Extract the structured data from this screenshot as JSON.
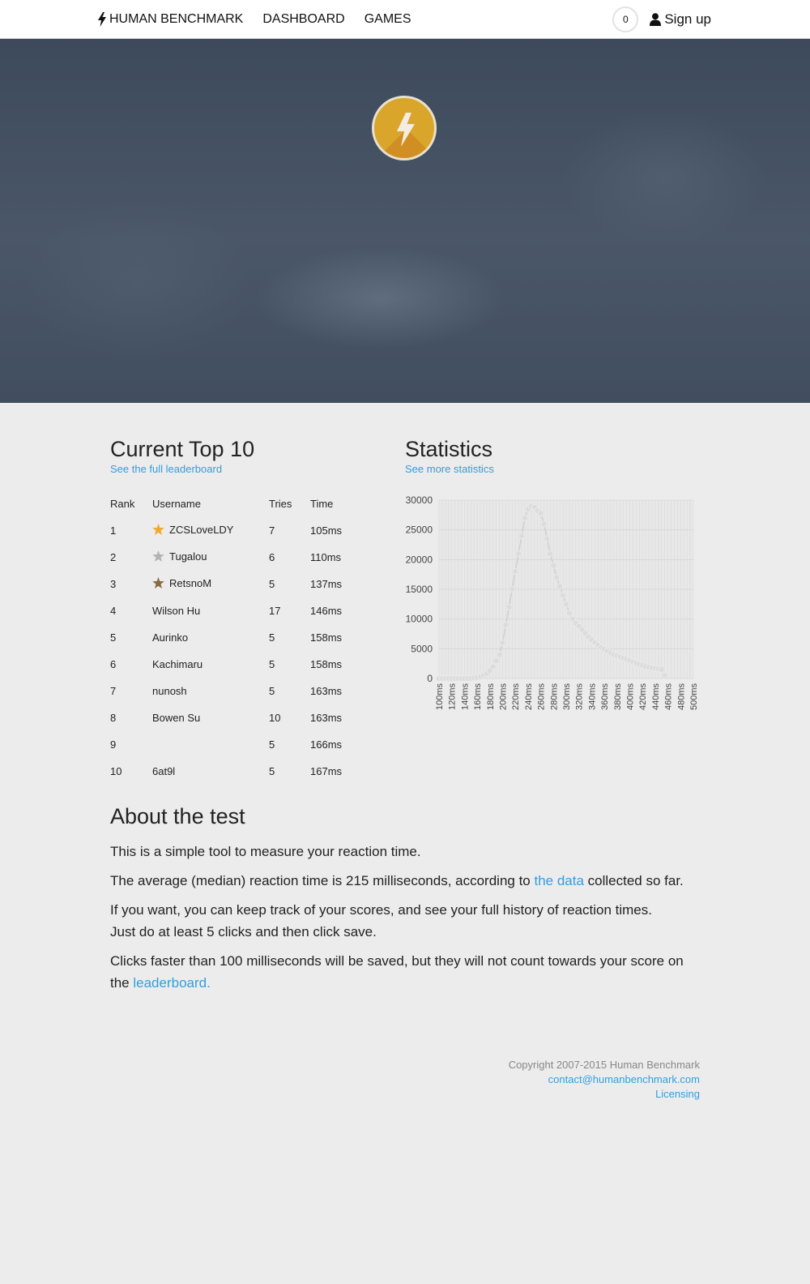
{
  "nav": {
    "brand": "HUMAN BENCHMARK",
    "links": [
      "DASHBOARD",
      "GAMES"
    ],
    "score": "0",
    "signup": "Sign up"
  },
  "top10": {
    "title": "Current Top 10",
    "link": "See the full leaderboard",
    "headers": [
      "Rank",
      "Username",
      "Tries",
      "Time"
    ],
    "rows": [
      {
        "rank": "1",
        "user": "ZCSLoveLDY",
        "tries": "7",
        "time": "105ms",
        "star": "gold"
      },
      {
        "rank": "2",
        "user": "Tugalou",
        "tries": "6",
        "time": "110ms",
        "star": "silver"
      },
      {
        "rank": "3",
        "user": "RetsnoM",
        "tries": "5",
        "time": "137ms",
        "star": "bronze"
      },
      {
        "rank": "4",
        "user": "Wilson Hu",
        "tries": "17",
        "time": "146ms",
        "star": ""
      },
      {
        "rank": "5",
        "user": "Aurinko",
        "tries": "5",
        "time": "158ms",
        "star": ""
      },
      {
        "rank": "6",
        "user": "Kachimaru",
        "tries": "5",
        "time": "158ms",
        "star": ""
      },
      {
        "rank": "7",
        "user": "nunosh",
        "tries": "5",
        "time": "163ms",
        "star": ""
      },
      {
        "rank": "8",
        "user": "Bowen Su",
        "tries": "10",
        "time": "163ms",
        "star": ""
      },
      {
        "rank": "9",
        "user": "",
        "tries": "5",
        "time": "166ms",
        "star": ""
      },
      {
        "rank": "10",
        "user": "6at9l",
        "tries": "5",
        "time": "167ms",
        "star": ""
      }
    ],
    "star_colors": {
      "gold": "#f0a830",
      "silver": "#b3b3b3",
      "bronze": "#8a6a45"
    }
  },
  "stats": {
    "title": "Statistics",
    "link": "See more statistics"
  },
  "chart_data": {
    "type": "line",
    "title": "",
    "xlabel": "",
    "ylabel": "",
    "ylim": [
      0,
      30000
    ],
    "yticks": [
      "0",
      "5000",
      "10000",
      "15000",
      "20000",
      "25000",
      "30000"
    ],
    "xticks": [
      "100ms",
      "120ms",
      "140ms",
      "160ms",
      "180ms",
      "200ms",
      "220ms",
      "240ms",
      "260ms",
      "280ms",
      "300ms",
      "320ms",
      "340ms",
      "360ms",
      "380ms",
      "400ms",
      "420ms",
      "440ms",
      "460ms",
      "480ms",
      "500ms"
    ],
    "x": [
      100,
      105,
      110,
      115,
      120,
      125,
      130,
      135,
      140,
      145,
      150,
      155,
      160,
      165,
      170,
      175,
      180,
      185,
      190,
      195,
      200,
      205,
      210,
      215,
      220,
      225,
      230,
      235,
      240,
      245,
      250,
      255,
      260,
      265,
      270,
      275,
      280,
      285,
      290,
      295,
      300,
      305,
      310,
      315,
      320,
      325,
      330,
      335,
      340,
      345,
      350,
      355,
      360,
      365,
      370,
      375,
      380,
      385,
      390,
      395,
      400,
      405,
      410,
      415,
      420,
      425,
      430,
      435,
      440,
      445,
      450,
      455,
      460,
      465,
      470,
      475,
      480,
      485,
      490,
      495,
      500
    ],
    "values": [
      0,
      0,
      0,
      0,
      0,
      0,
      0,
      0,
      0,
      0,
      0,
      100,
      200,
      300,
      500,
      800,
      1300,
      2000,
      3000,
      4000,
      6000,
      9000,
      12000,
      15000,
      18000,
      21000,
      24000,
      27000,
      28500,
      29000,
      28800,
      28200,
      27800,
      26000,
      23500,
      21000,
      19000,
      17000,
      15500,
      14000,
      12500,
      11000,
      10000,
      9300,
      8800,
      8200,
      7600,
      7000,
      6500,
      6000,
      5600,
      5200,
      4900,
      4600,
      4300,
      4000,
      3800,
      3600,
      3400,
      3200,
      3000,
      2800,
      2600,
      2400,
      2200,
      2000,
      1900,
      1800,
      1700,
      1600,
      1500,
      500
    ],
    "grid": true,
    "legend": "none",
    "point_color": "#dcdcdc"
  },
  "about": {
    "title": "About the test",
    "p1": "This is a simple tool to measure your reaction time.",
    "p2_a": "The average (median) reaction time is 215 milliseconds, according to ",
    "p2_link": "the data",
    "p2_b": " collected so far.",
    "p3_a": "If you want, you can keep track of your scores, and see your full history of reaction times.",
    "p3_b": "Just do at least 5 clicks and then click save.",
    "p4_a": "Clicks faster than 100 milliseconds will be saved, but they will not count towards your score on the ",
    "p4_link": "leaderboard."
  },
  "footer": {
    "copyright": "Copyright 2007-2015 Human Benchmark",
    "email": "contact@humanbenchmark.com",
    "licensing": "Licensing"
  }
}
